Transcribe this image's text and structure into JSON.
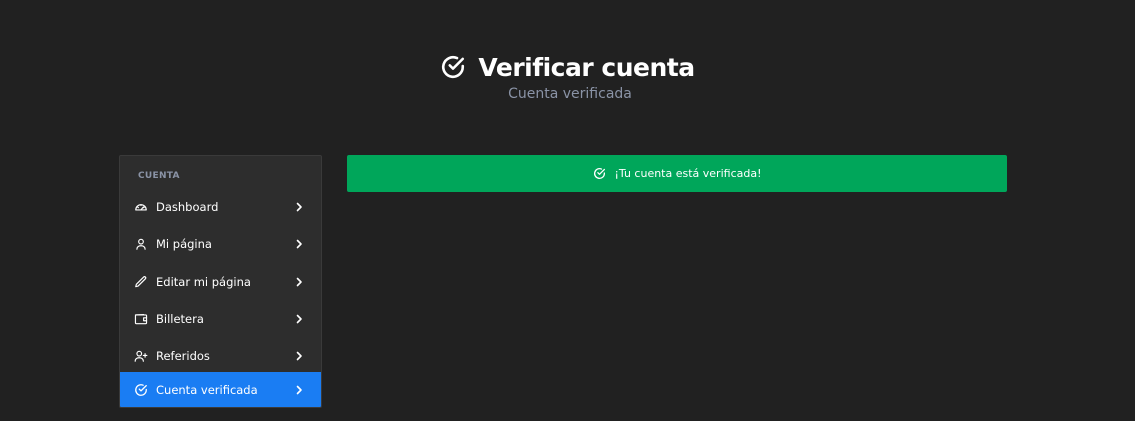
{
  "header": {
    "title": "Verificar cuenta",
    "subtitle": "Cuenta verificada",
    "icon": "check-circle-icon"
  },
  "sidebar": {
    "heading": "CUENTA",
    "items": [
      {
        "label": "Dashboard",
        "icon": "dashboard-gauge-icon",
        "active": false
      },
      {
        "label": "Mi página",
        "icon": "user-icon",
        "active": false
      },
      {
        "label": "Editar mi página",
        "icon": "pencil-icon",
        "active": false
      },
      {
        "label": "Billetera",
        "icon": "wallet-icon",
        "active": false
      },
      {
        "label": "Referidos",
        "icon": "user-plus-icon",
        "active": false
      },
      {
        "label": "Cuenta verificada",
        "icon": "check-circle-icon",
        "active": true
      }
    ]
  },
  "alert": {
    "text": "¡Tu cuenta está verificada!",
    "icon": "check-circle-icon"
  },
  "colors": {
    "background": "#212121",
    "sidebar_bg": "#2d2d2d",
    "active_item": "#1a7df3",
    "success": "#00a65a",
    "muted_text": "#8a93a6"
  }
}
